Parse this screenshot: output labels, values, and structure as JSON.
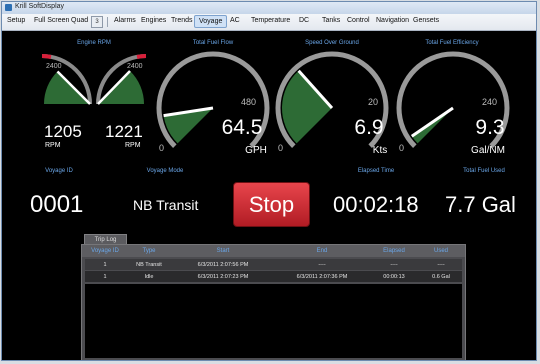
{
  "window": {
    "title": "Krill SoftDisplay"
  },
  "menu": {
    "setup": "Setup",
    "full_screen": "Full Screen",
    "quad": "Quad",
    "quad_btn": "3",
    "tabs": [
      "Alarms",
      "Engines",
      "Trends",
      "Voyage",
      "AC",
      "Temperature",
      "DC",
      "Tanks",
      "Control",
      "Navigation",
      "Gensets"
    ],
    "selected_tab": "Voyage"
  },
  "gauges": {
    "engine_rpm": {
      "label": "Engine RPM",
      "max_tick": "2400",
      "left": {
        "value": "1205",
        "unit": "RPM",
        "fraction": 0.5
      },
      "right": {
        "value": "1221",
        "unit": "RPM",
        "fraction": 0.51
      }
    },
    "fuel_flow": {
      "label": "Total Fuel Flow",
      "min": "0",
      "max": "480",
      "value": "64.5",
      "unit": "GPH",
      "fraction": 0.134
    },
    "speed": {
      "label": "Speed Over Ground",
      "min": "0",
      "max": "20",
      "value": "6.9",
      "unit": "Kts",
      "fraction": 0.345
    },
    "efficiency": {
      "label": "Total Fuel Efficiency",
      "min": "0",
      "max": "240",
      "value": "9.3",
      "unit": "Gal/NM",
      "fraction": 0.039
    }
  },
  "status": {
    "voyage_id_label": "Voyage ID",
    "voyage_id": "0001",
    "mode_label": "Voyage Mode",
    "mode": "NB Transit",
    "stop_label": "Stop",
    "elapsed_label": "Elapsed Time",
    "elapsed": "00:02:18",
    "fuel_used_label": "Total Fuel Used",
    "fuel_used": "7.7 Gal"
  },
  "trip_log": {
    "tab": "Trip Log",
    "columns": [
      "Voyage ID",
      "Type",
      "Start",
      "End",
      "Elapsed",
      "Used"
    ],
    "rows": [
      [
        "1",
        "NB Transit",
        "6/3/2011 2:07:56 PM",
        "----",
        "----",
        "----"
      ],
      [
        "1",
        "Idle",
        "6/3/2011 2:07:23 PM",
        "6/3/2011 2:07:36 PM",
        "00:00:13",
        "0.6 Gal"
      ]
    ]
  }
}
